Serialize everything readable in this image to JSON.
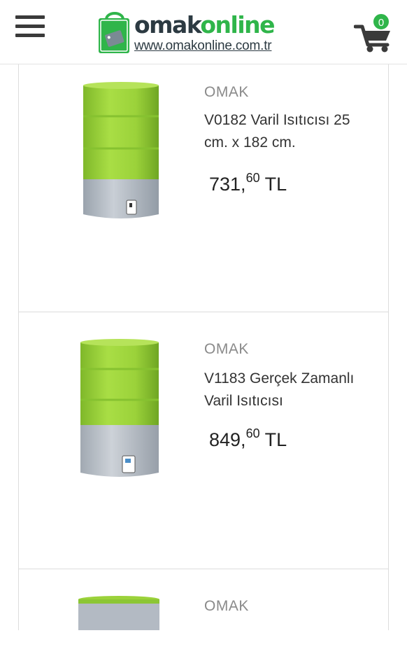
{
  "header": {
    "logo_word_dark": "omak",
    "logo_word_green": "online",
    "logo_url": "www.omakonline.com.tr",
    "cart_count": "0",
    "icons": {
      "menu": "hamburger-menu-icon",
      "cart": "shopping-cart-icon"
    }
  },
  "products": [
    {
      "brand": "OMAK",
      "name": "V0182 Varil Isıtıcısı 25 cm. x 182 cm.",
      "price_int": "731,",
      "price_dec": "60",
      "currency": "TL"
    },
    {
      "brand": "OMAK",
      "name": "V1183 Gerçek Zamanlı Varil Isıtıcısı",
      "price_int": "849,",
      "price_dec": "60",
      "currency": "TL"
    },
    {
      "brand": "OMAK"
    }
  ],
  "colors": {
    "brand_green": "#2fb54a",
    "brand_dark": "#2c3a42",
    "barrel_green": "#9bd23a",
    "jacket_grey": "#b9c0c8"
  }
}
